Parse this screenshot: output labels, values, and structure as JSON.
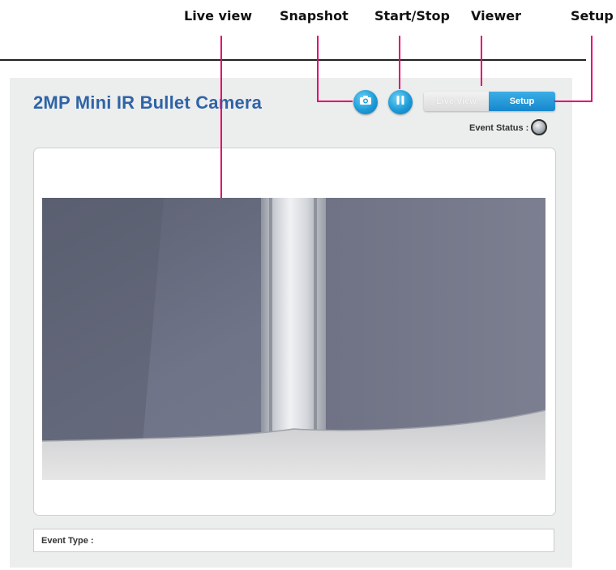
{
  "callouts": {
    "live_view": "Live view",
    "snapshot": "Snapshot",
    "start_stop": "Start/Stop",
    "viewer": "Viewer",
    "setup": "Setup"
  },
  "header": {
    "title": "2MP Mini IR Bullet Camera",
    "snapshot_icon": "camera-icon",
    "start_stop_icon": "pause-icon"
  },
  "view_toggle": {
    "live_view_label": "Live View",
    "setup_label": "Setup",
    "active": "Setup"
  },
  "event_status": {
    "label": "Event Status :"
  },
  "event_type": {
    "label": "Event Type :"
  },
  "colors": {
    "title": "#2f64a6",
    "callout_leader": "#e4006a",
    "button_blue": "#1c9bd8",
    "panel_bg": "#eceded"
  }
}
